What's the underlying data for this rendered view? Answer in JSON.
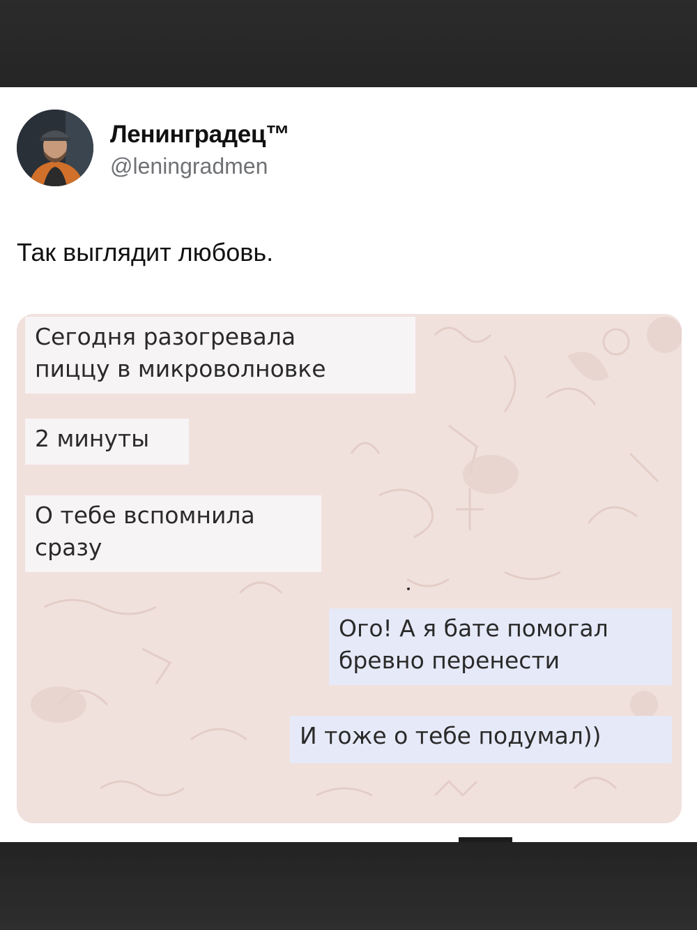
{
  "post": {
    "author_name": "Ленинградец™",
    "author_handle": "@leningradmen",
    "text": "Так выглядит любовь."
  },
  "chat": {
    "messages": [
      {
        "side": "incoming",
        "text": "Сегодня разогревала\nпиццу в микроволновке"
      },
      {
        "side": "incoming",
        "text": "2 минуты"
      },
      {
        "side": "incoming",
        "text": "О тебе вспомнила\nсразу"
      },
      {
        "side": "outgoing",
        "text": "Ого! А я бате помогал\nбревно перенести"
      },
      {
        "side": "outgoing",
        "text": "И тоже о тебе подумал))"
      }
    ]
  },
  "colors": {
    "chat_background": "#f1e1dd",
    "incoming_bubble": "#f7f4f6",
    "outgoing_bubble": "#e6e9f7"
  }
}
